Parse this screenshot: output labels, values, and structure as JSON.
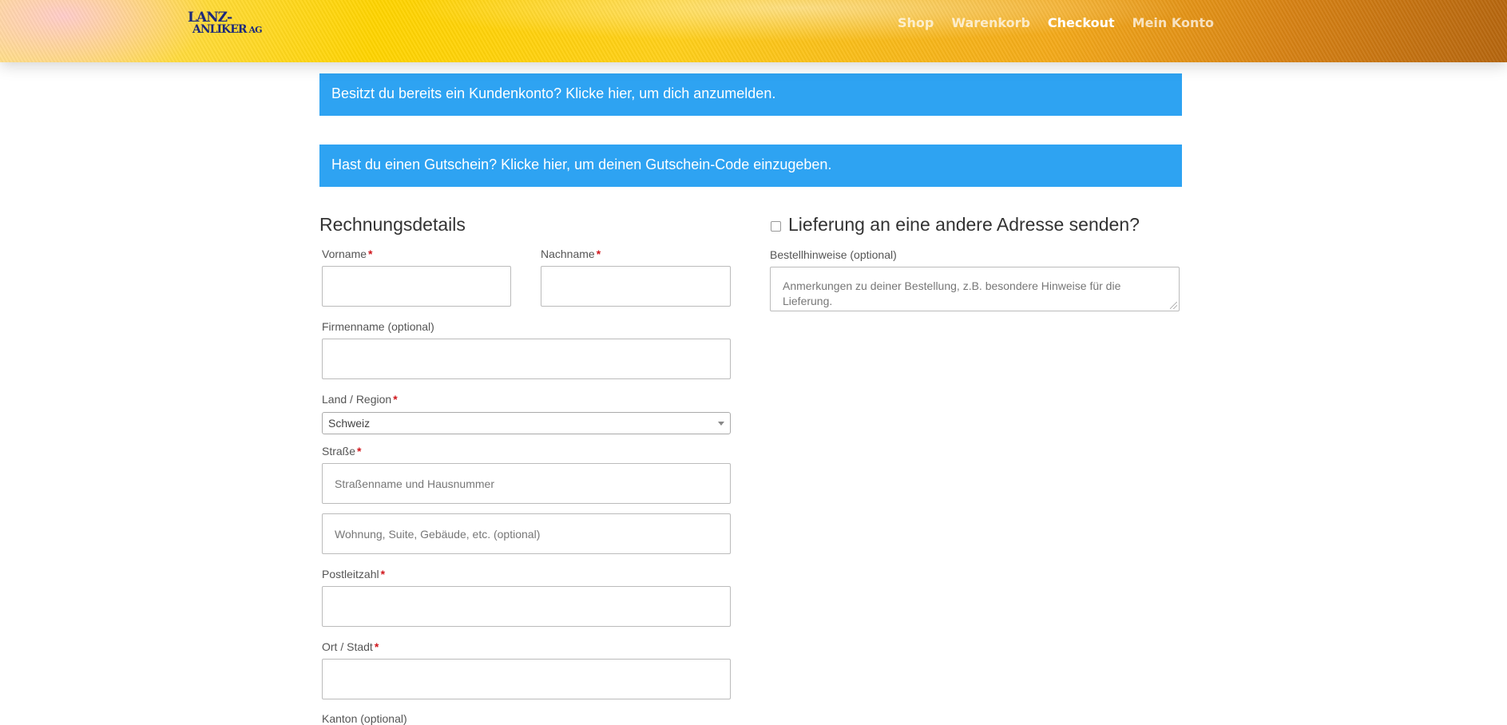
{
  "header": {
    "logo_line1": "LANZ-",
    "logo_line2": "ANLIKER",
    "logo_suffix": "AG",
    "nav": {
      "shop": "Shop",
      "cart": "Warenkorb",
      "checkout": "Checkout",
      "account": "Mein Konto"
    },
    "active_nav": "Checkout"
  },
  "notices": {
    "login": "Besitzt du bereits ein Kundenkonto? Klicke hier, um dich anzumelden.",
    "coupon": "Hast du einen Gutschein? Klicke hier, um deinen Gutschein-Code einzugeben."
  },
  "billing": {
    "title": "Rechnungsdetails",
    "first_name_label": "Vorname",
    "last_name_label": "Nachname",
    "company_label": "Firmenname (optional)",
    "country_label": "Land / Region",
    "country_value": "Schweiz",
    "street_label": "Straße",
    "street_placeholder": "Straßenname und Hausnummer",
    "street2_placeholder": "Wohnung, Suite, Gebäude, etc. (optional)",
    "postcode_label": "Postleitzahl",
    "city_label": "Ort / Stadt",
    "state_label": "Kanton (optional)",
    "required_marker": "*"
  },
  "shipping": {
    "ship_different_label": "Lieferung an eine andere Adresse senden?",
    "ship_different_checked": false,
    "notes_label": "Bestellhinweise (optional)",
    "notes_placeholder": "Anmerkungen zu deiner Bestellung, z.B. besondere Hinweise für die Lieferung."
  },
  "colors": {
    "notice_bg": "#2ea3f2",
    "required": "#d0161c",
    "nav_active": "#ffffff"
  }
}
